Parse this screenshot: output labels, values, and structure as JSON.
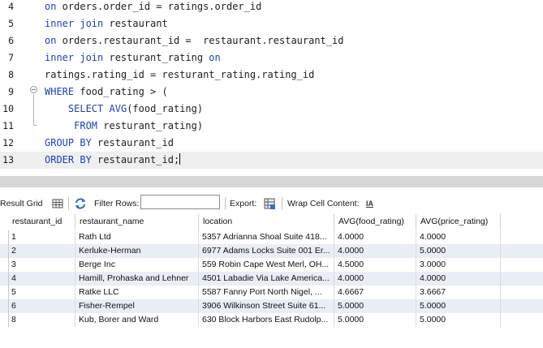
{
  "editor": {
    "lines": [
      {
        "no": "4",
        "tokens": [
          {
            "t": "kw",
            "s": "on"
          },
          {
            "t": "tx",
            "s": " orders.order_id = ratings.order_id"
          }
        ]
      },
      {
        "no": "5",
        "tokens": [
          {
            "t": "kw",
            "s": "inner join"
          },
          {
            "t": "tx",
            "s": " restaurant"
          }
        ]
      },
      {
        "no": "6",
        "tokens": [
          {
            "t": "kw",
            "s": "on"
          },
          {
            "t": "tx",
            "s": " orders.restaurant_id =  restaurant.restaurant_id"
          }
        ]
      },
      {
        "no": "7",
        "tokens": [
          {
            "t": "kw",
            "s": "inner join"
          },
          {
            "t": "tx",
            "s": " resturant_rating "
          },
          {
            "t": "kw",
            "s": "on"
          }
        ]
      },
      {
        "no": "8",
        "tokens": [
          {
            "t": "tx",
            "s": "ratings.rating_id = resturant_rating.rating_id"
          }
        ]
      },
      {
        "no": "9",
        "tokens": [
          {
            "t": "kw",
            "s": "WHERE"
          },
          {
            "t": "tx",
            "s": " food_rating > ("
          }
        ]
      },
      {
        "no": "10",
        "tokens": [
          {
            "t": "tx",
            "s": "    "
          },
          {
            "t": "kw",
            "s": "SELECT"
          },
          {
            "t": "tx",
            "s": " "
          },
          {
            "t": "fn",
            "s": "AVG"
          },
          {
            "t": "tx",
            "s": "(food_rating)"
          }
        ]
      },
      {
        "no": "11",
        "tokens": [
          {
            "t": "tx",
            "s": "     "
          },
          {
            "t": "kw",
            "s": "FROM"
          },
          {
            "t": "tx",
            "s": " resturant_rating)"
          }
        ]
      },
      {
        "no": "12",
        "tokens": [
          {
            "t": "kw",
            "s": "GROUP BY"
          },
          {
            "t": "tx",
            "s": " restaurant_id"
          }
        ]
      },
      {
        "no": "13",
        "tokens": [
          {
            "t": "kw",
            "s": "ORDER BY"
          },
          {
            "t": "tx",
            "s": " restaurant_id;"
          }
        ],
        "current": true
      }
    ]
  },
  "toolbar": {
    "result_grid_label": "Result Grid",
    "filter_rows_label": "Filter Rows:",
    "filter_rows_value": "",
    "export_label": "Export:",
    "wrap_cell_label": "Wrap Cell Content:",
    "wrap_icon_glyph": "IA"
  },
  "grid": {
    "columns": [
      "restaurant_id",
      "restaurant_name",
      "location",
      "AVG(food_rating)",
      "AVG(price_rating)"
    ],
    "rows": [
      [
        "1",
        "Rath Ltd",
        "5357 Adrianna Shoal Suite 418...",
        "4.0000",
        "4.0000"
      ],
      [
        "2",
        "Kerluke-Herman",
        "6977 Adams Locks Suite 001 Er...",
        "4.0000",
        "5.0000"
      ],
      [
        "3",
        "Berge Inc",
        "559 Robin Cape West Merl, OH...",
        "4.5000",
        "3.0000"
      ],
      [
        "4",
        "Hamill, Prohaska and Lehner",
        "4501 Labadie Via Lake America...",
        "4.0000",
        "4.0000"
      ],
      [
        "5",
        "Ratke LLC",
        "5587 Fanny Port North Nigel, ...",
        "4.6667",
        "3.6667"
      ],
      [
        "6",
        "Fisher-Rempel",
        "3906 Wilkinson Street Suite 61...",
        "5.0000",
        "5.0000"
      ],
      [
        "8",
        "Kub, Borer and Ward",
        "630 Block Harbors East Rudolp...",
        "5.0000",
        "5.0000"
      ]
    ]
  },
  "colors": {
    "keyword": "#1e3fb8",
    "alt_row": "#e9edf6",
    "current_line": "#efefef",
    "splitter": "#d6d6d6"
  }
}
